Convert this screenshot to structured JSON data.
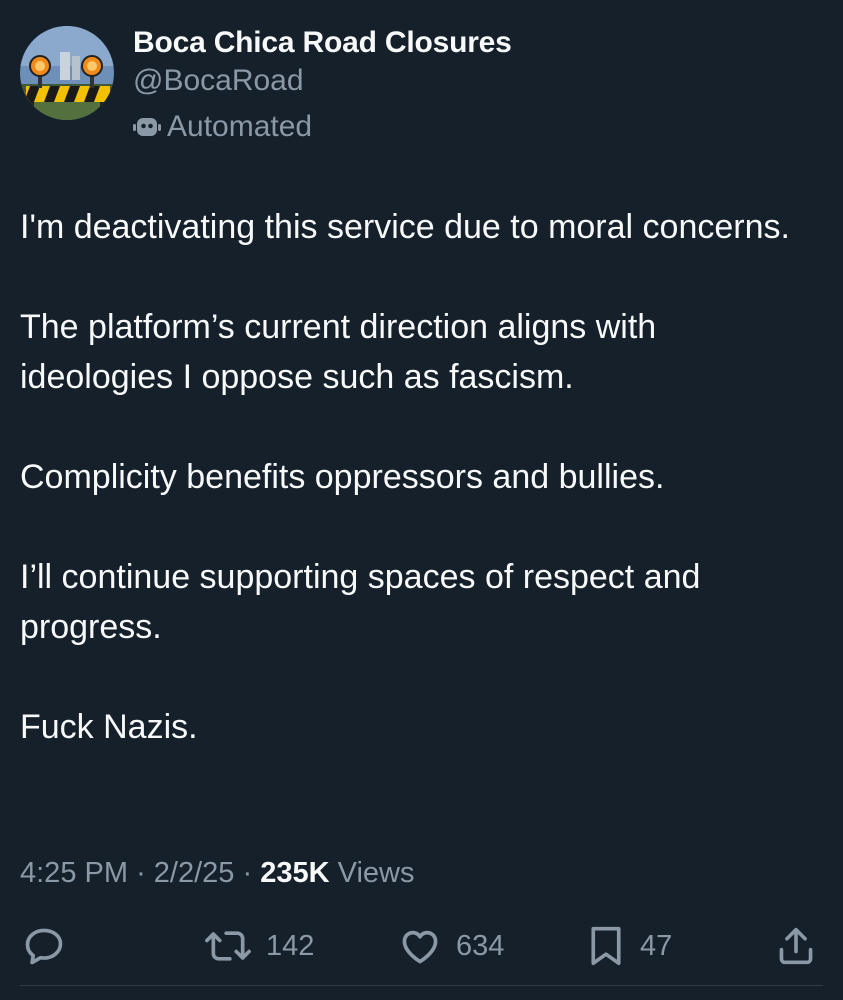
{
  "author": {
    "display_name": "Boca Chica Road Closures",
    "handle": "@BocaRoad",
    "label": "Automated",
    "avatar_icon": "road-barricade-avatar"
  },
  "tweet": {
    "paragraphs": [
      "I'm deactivating this service due to moral concerns.",
      "The platform’s current direction aligns with ideologies I oppose such as fascism.",
      "Complicity benefits oppressors and bullies.",
      "I’ll continue supporting spaces of respect and progress.",
      "Fuck Nazis."
    ]
  },
  "meta": {
    "time": "4:25 PM",
    "separator": "·",
    "date": "2/2/25",
    "views_count": "235K",
    "views_label": "Views"
  },
  "actions": {
    "reply": {
      "icon": "reply-icon",
      "count": ""
    },
    "retweet": {
      "icon": "retweet-icon",
      "count": "142"
    },
    "like": {
      "icon": "heart-icon",
      "count": "634"
    },
    "bookmark": {
      "icon": "bookmark-icon",
      "count": "47"
    },
    "share": {
      "icon": "share-icon"
    }
  },
  "colors": {
    "background": "#15202b",
    "text_primary": "#f7f9f9",
    "text_secondary": "#8b98a5"
  }
}
